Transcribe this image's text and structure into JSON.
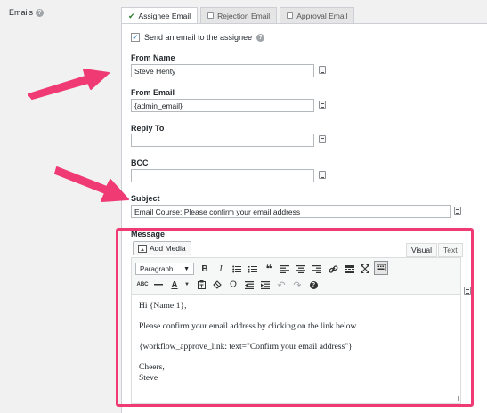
{
  "emails": {
    "label": "Emails"
  },
  "tabs": [
    {
      "label": "Assignee Email",
      "active": true
    },
    {
      "label": "Rejection Email",
      "active": false
    },
    {
      "label": "Approval Email",
      "active": false
    }
  ],
  "assignee": {
    "send_email_label": "Send an email to the assignee",
    "send_email_checked": true,
    "from_name": {
      "label": "From Name",
      "value": "Steve Henty"
    },
    "from_email": {
      "label": "From Email",
      "value": "{admin_email}"
    },
    "reply_to": {
      "label": "Reply To",
      "value": ""
    },
    "bcc": {
      "label": "BCC",
      "value": ""
    },
    "subject": {
      "label": "Subject",
      "value": "Email Course: Please confirm your email address"
    },
    "message": {
      "label": "Message",
      "add_media_label": "Add Media",
      "visual_tab": "Visual",
      "text_tab": "Text",
      "format_select": "Paragraph",
      "body_lines": [
        "Hi {Name:1},",
        "Please confirm your email address by clicking on the link below.",
        "{workflow_approve_link: text=\"Confirm your email address\"}",
        "Cheers,",
        "Steve"
      ]
    }
  },
  "annotations": {
    "arrow_color": "#ef3a74",
    "highlight_color": "#ef3a74"
  },
  "colors": {
    "check_color": "#1e73be"
  }
}
